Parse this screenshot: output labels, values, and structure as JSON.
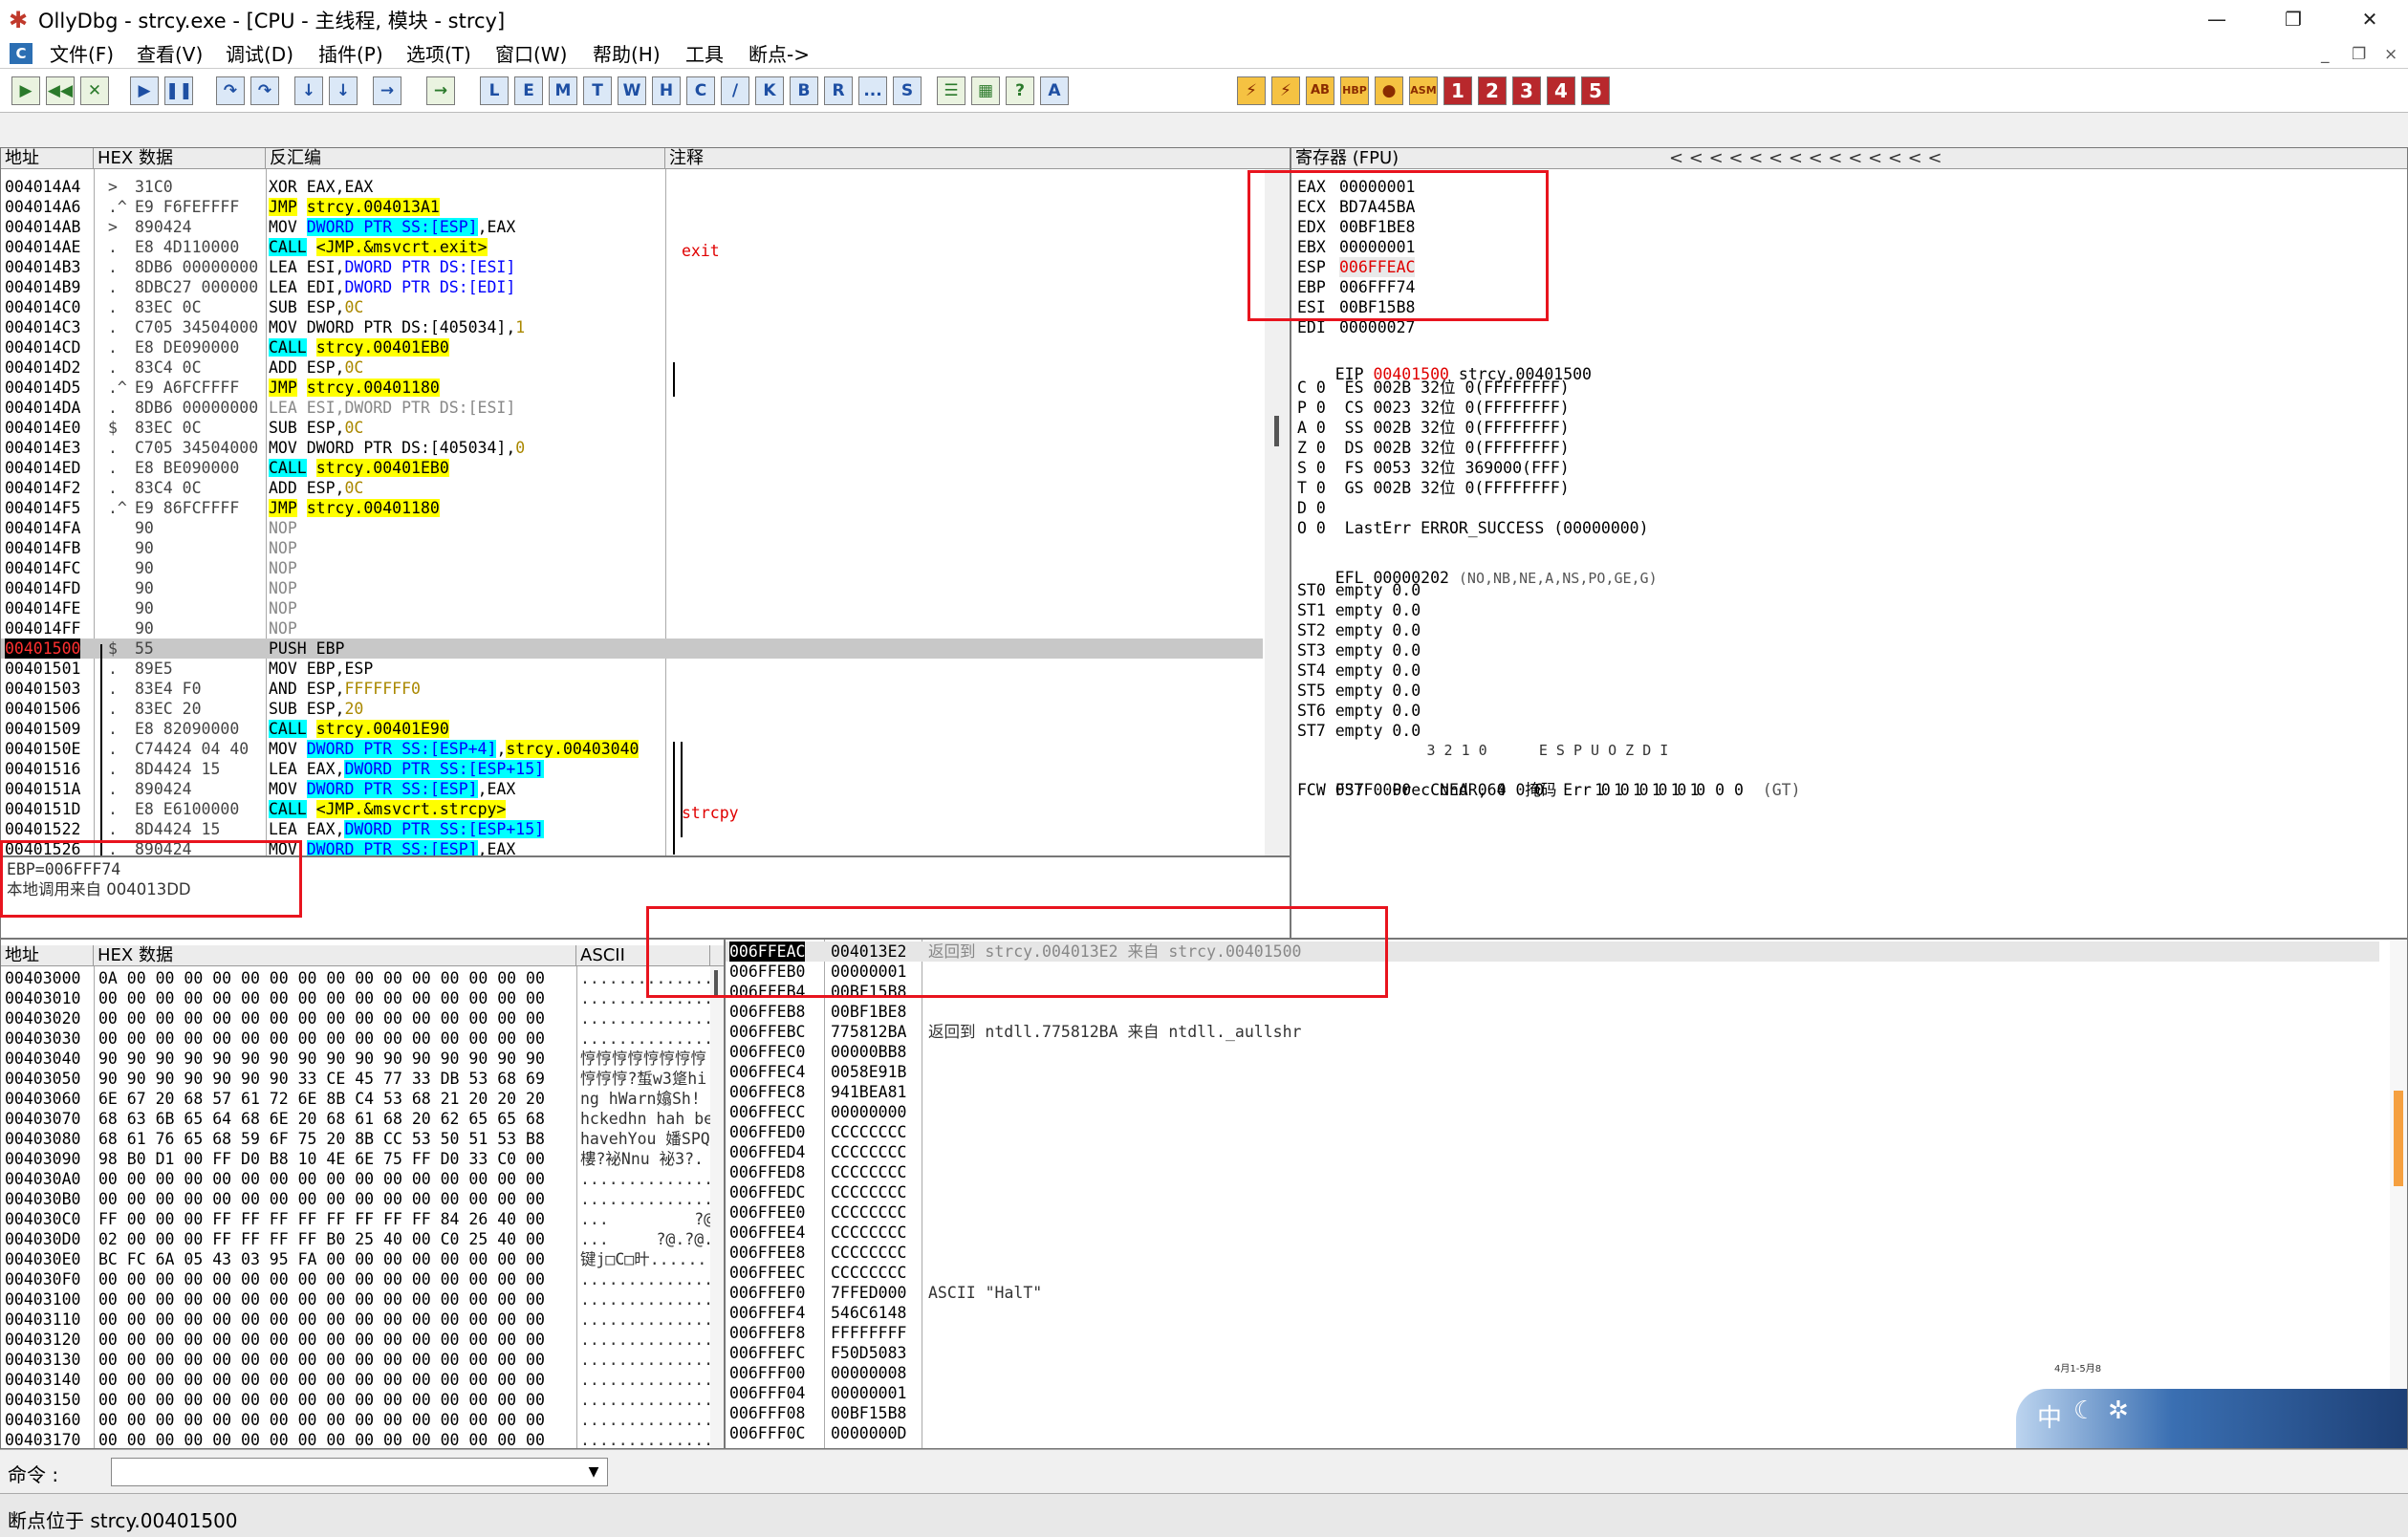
{
  "window": {
    "title": "OllyDbg - strcy.exe - [CPU - 主线程, 模块 - strcy]",
    "controls": [
      "—",
      "❐",
      "✕"
    ]
  },
  "menu": {
    "items": [
      "文件(F)",
      "查看(V)",
      "调试(D)",
      "插件(P)",
      "选项(T)",
      "窗口(W)",
      "帮助(H)",
      "工具",
      "断点->"
    ],
    "mdi_controls": [
      "_",
      "❐",
      "×"
    ]
  },
  "toolbar": {
    "nav_buttons": [
      "▶",
      "◀◀",
      "✕",
      "▶",
      "❚❚",
      "↷",
      "↷",
      "↓",
      "↓",
      "→",
      "→"
    ],
    "letter_buttons": [
      "L",
      "E",
      "M",
      "T",
      "W",
      "H",
      "C",
      "/",
      "K",
      "B",
      "R",
      "...",
      "S"
    ],
    "misc_buttons": [
      "☰",
      "▦",
      "?",
      "A"
    ],
    "right_buttons": [
      "⚡",
      "⚡",
      "AB",
      "HBP",
      "●",
      "ASM"
    ],
    "number_buttons": [
      "1",
      "2",
      "3",
      "4",
      "5"
    ]
  },
  "disasm": {
    "headers": [
      "地址",
      "HEX 数据",
      "反汇编",
      "注释"
    ],
    "rows": [
      {
        "addr": "004014A4",
        "m": ">",
        "hex": "31C0",
        "dis": [
          {
            "t": "XOR EAX,EAX"
          }
        ]
      },
      {
        "addr": "004014A6",
        "m": ".^",
        "hex": "E9 F6FEFFFF",
        "dis": [
          {
            "t": "JMP",
            "h": "y"
          },
          {
            "t": " "
          },
          {
            "t": "strcy.004013A1",
            "h": "y"
          }
        ]
      },
      {
        "addr": "004014AB",
        "m": ">",
        "hex": "890424",
        "dis": [
          {
            "t": "MOV "
          },
          {
            "t": "DWORD PTR SS:[ESP]",
            "h": "c"
          },
          {
            "t": ",EAX"
          }
        ]
      },
      {
        "addr": "004014AE",
        "m": ".",
        "hex": "E8 4D110000",
        "dis": [
          {
            "t": "CALL",
            "h": "c"
          },
          {
            "t": " "
          },
          {
            "t": "<JMP.&msvcrt.exit>",
            "h": "y"
          }
        ]
      },
      {
        "addr": "004014B3",
        "m": ".",
        "hex": "8DB6 00000000",
        "dis": [
          {
            "t": "LEA ESI,"
          },
          {
            "t": "DWORD PTR DS:[ESI]",
            "h": "b"
          }
        ]
      },
      {
        "addr": "004014B9",
        "m": ".",
        "hex": "8DBC27 000000",
        "dis": [
          {
            "t": "LEA EDI,"
          },
          {
            "t": "DWORD PTR DS:[EDI]",
            "h": "b"
          }
        ]
      },
      {
        "addr": "004014C0",
        "m": ".",
        "hex": "83EC 0C",
        "dis": [
          {
            "t": "SUB ESP,"
          },
          {
            "t": "0C",
            "h": "o"
          }
        ]
      },
      {
        "addr": "004014C3",
        "m": ".",
        "hex": "C705 34504000",
        "dis": [
          {
            "t": "MOV DWORD PTR DS:[405034],"
          },
          {
            "t": "1",
            "h": "o"
          }
        ]
      },
      {
        "addr": "004014CD",
        "m": ".",
        "hex": "E8 DE090000",
        "dis": [
          {
            "t": "CALL",
            "h": "c"
          },
          {
            "t": " "
          },
          {
            "t": "strcy.00401EB0",
            "h": "y"
          }
        ]
      },
      {
        "addr": "004014D2",
        "m": ".",
        "hex": "83C4 0C",
        "dis": [
          {
            "t": "ADD ESP,"
          },
          {
            "t": "0C",
            "h": "o"
          }
        ]
      },
      {
        "addr": "004014D5",
        "m": ".^",
        "hex": "E9 A6FCFFFF",
        "dis": [
          {
            "t": "JMP",
            "h": "y"
          },
          {
            "t": " "
          },
          {
            "t": "strcy.00401180",
            "h": "y"
          }
        ]
      },
      {
        "addr": "004014DA",
        "m": ".",
        "hex": "8DB6 00000000",
        "dis": [
          {
            "t": "LEA ESI,DWORD PTR DS:[ESI]",
            "h": "g"
          }
        ]
      },
      {
        "addr": "004014E0",
        "m": "$",
        "hex": "83EC 0C",
        "dis": [
          {
            "t": "SUB ESP,"
          },
          {
            "t": "0C",
            "h": "o"
          }
        ]
      },
      {
        "addr": "004014E3",
        "m": ".",
        "hex": "C705 34504000",
        "dis": [
          {
            "t": "MOV DWORD PTR DS:[405034],"
          },
          {
            "t": "0",
            "h": "o"
          }
        ]
      },
      {
        "addr": "004014ED",
        "m": ".",
        "hex": "E8 BE090000",
        "dis": [
          {
            "t": "CALL",
            "h": "c"
          },
          {
            "t": " "
          },
          {
            "t": "strcy.00401EB0",
            "h": "y"
          }
        ]
      },
      {
        "addr": "004014F2",
        "m": ".",
        "hex": "83C4 0C",
        "dis": [
          {
            "t": "ADD ESP,"
          },
          {
            "t": "0C",
            "h": "o"
          }
        ]
      },
      {
        "addr": "004014F5",
        "m": ".^",
        "hex": "E9 86FCFFFF",
        "dis": [
          {
            "t": "JMP",
            "h": "y"
          },
          {
            "t": " "
          },
          {
            "t": "strcy.00401180",
            "h": "y"
          }
        ]
      },
      {
        "addr": "004014FA",
        "m": "",
        "hex": "90",
        "dis": [
          {
            "t": "NOP",
            "h": "g"
          }
        ]
      },
      {
        "addr": "004014FB",
        "m": "",
        "hex": "90",
        "dis": [
          {
            "t": "NOP",
            "h": "g"
          }
        ]
      },
      {
        "addr": "004014FC",
        "m": "",
        "hex": "90",
        "dis": [
          {
            "t": "NOP",
            "h": "g"
          }
        ]
      },
      {
        "addr": "004014FD",
        "m": "",
        "hex": "90",
        "dis": [
          {
            "t": "NOP",
            "h": "g"
          }
        ]
      },
      {
        "addr": "004014FE",
        "m": "",
        "hex": "90",
        "dis": [
          {
            "t": "NOP",
            "h": "g"
          }
        ]
      },
      {
        "addr": "004014FF",
        "m": "",
        "hex": "90",
        "dis": [
          {
            "t": "NOP",
            "h": "g"
          }
        ]
      },
      {
        "addr": "00401500",
        "m": "$",
        "hex": "55",
        "dis": [
          {
            "t": "PUSH EBP"
          }
        ],
        "sel": true
      },
      {
        "addr": "00401501",
        "m": ".",
        "hex": "89E5",
        "dis": [
          {
            "t": "MOV EBP,ESP"
          }
        ]
      },
      {
        "addr": "00401503",
        "m": ".",
        "hex": "83E4 F0",
        "dis": [
          {
            "t": "AND ESP,"
          },
          {
            "t": "FFFFFFF0",
            "h": "o"
          }
        ]
      },
      {
        "addr": "00401506",
        "m": ".",
        "hex": "83EC 20",
        "dis": [
          {
            "t": "SUB ESP,"
          },
          {
            "t": "20",
            "h": "o"
          }
        ]
      },
      {
        "addr": "00401509",
        "m": ".",
        "hex": "E8 82090000",
        "dis": [
          {
            "t": "CALL",
            "h": "c"
          },
          {
            "t": " "
          },
          {
            "t": "strcy.00401E90",
            "h": "y"
          }
        ]
      },
      {
        "addr": "0040150E",
        "m": ".",
        "hex": "C74424 04 40",
        "dis": [
          {
            "t": "MOV "
          },
          {
            "t": "DWORD PTR SS:[ESP+4]",
            "h": "c"
          },
          {
            "t": ","
          },
          {
            "t": "strcy.00403040",
            "h": "y"
          }
        ]
      },
      {
        "addr": "00401516",
        "m": ".",
        "hex": "8D4424 15",
        "dis": [
          {
            "t": "LEA EAX,"
          },
          {
            "t": "DWORD PTR SS:[ESP+15]",
            "h": "c"
          }
        ]
      },
      {
        "addr": "0040151A",
        "m": ".",
        "hex": "890424",
        "dis": [
          {
            "t": "MOV "
          },
          {
            "t": "DWORD PTR SS:[ESP]",
            "h": "c"
          },
          {
            "t": ",EAX"
          }
        ]
      },
      {
        "addr": "0040151D",
        "m": ".",
        "hex": "E8 E6100000",
        "dis": [
          {
            "t": "CALL",
            "h": "c"
          },
          {
            "t": " "
          },
          {
            "t": "<JMP.&msvcrt.strcpy>",
            "h": "y"
          }
        ]
      },
      {
        "addr": "00401522",
        "m": ".",
        "hex": "8D4424 15",
        "dis": [
          {
            "t": "LEA EAX,"
          },
          {
            "t": "DWORD PTR SS:[ESP+15]",
            "h": "c"
          }
        ]
      },
      {
        "addr": "00401526",
        "m": ".",
        "hex": "890424",
        "dis": [
          {
            "t": "MOV "
          },
          {
            "t": "DWORD PTR SS:[ESP]",
            "h": "c"
          },
          {
            "t": ",EAX"
          }
        ]
      }
    ],
    "comments": [
      {
        "row": 3,
        "text": "exit"
      },
      {
        "row": 31,
        "text": "strcpy"
      }
    ]
  },
  "info": {
    "line1": "EBP=006FFF74",
    "line2": "本地调用来自 004013DD"
  },
  "registers": {
    "title": "寄存器 (FPU)",
    "nav_arrows": "<   <   <   <   <   <   <   <   <   <   <   <   <   <",
    "gp": [
      {
        "name": "EAX",
        "val": "00000001",
        "note": ""
      },
      {
        "name": "ECX",
        "val": "BD7A45BA",
        "note": ""
      },
      {
        "name": "EDX",
        "val": "00BF1BE8",
        "note": ""
      },
      {
        "name": "EBX",
        "val": "00000001",
        "note": ""
      },
      {
        "name": "ESP",
        "val": "006FFEAC",
        "note": "",
        "hl": true
      },
      {
        "name": "EBP",
        "val": "006FFF74",
        "note": ""
      },
      {
        "name": "ESI",
        "val": "00BF15B8",
        "note": ""
      },
      {
        "name": "EDI",
        "val": "00000027",
        "note": ""
      }
    ],
    "eip": {
      "name": "EIP",
      "val": "00401500",
      "note": "strcy.00401500"
    },
    "flags": [
      "C 0  ES 002B 32位 0(FFFFFFFF)",
      "P 0  CS 0023 32位 0(FFFFFFFF)",
      "A 0  SS 002B 32位 0(FFFFFFFF)",
      "Z 0  DS 002B 32位 0(FFFFFFFF)",
      "S 0  FS 0053 32位 369000(FFF)",
      "T 0  GS 002B 32位 0(FFFFFFFF)",
      "D 0",
      "O 0  LastErr ERROR_SUCCESS (00000000)"
    ],
    "efl": {
      "label": "EFL 00000202",
      "note": "(NO,NB,NE,A,NS,PO,GE,G)"
    },
    "fpu": [
      "ST0 empty 0.0",
      "ST1 empty 0.0",
      "ST2 empty 0.0",
      "ST3 empty 0.0",
      "ST4 empty 0.0",
      "ST5 empty 0.0",
      "ST6 empty 0.0",
      "ST7 empty 0.0"
    ],
    "fpu_hdr": "               3 2 1 0      E S P U O Z D I",
    "fst": "FST 0000  Cond 0 0 0 0  Err 0 0 0 0 0 0 0 0",
    "fst_note": "(GT)",
    "fcw": "FCW 037F  Prec NEAR,64  掩码    1 1 1 1 1 1"
  },
  "dump": {
    "headers": [
      "地址",
      "HEX 数据",
      "ASCII"
    ],
    "rows": [
      {
        "addr": "00403000",
        "hex": "0A 00 00 00 00 00 00 00 00 00 00 00 00 00 00 00",
        "ascii": "................"
      },
      {
        "addr": "00403010",
        "hex": "00 00 00 00 00 00 00 00 00 00 00 00 00 00 00 00",
        "ascii": "................"
      },
      {
        "addr": "00403020",
        "hex": "00 00 00 00 00 00 00 00 00 00 00 00 00 00 00 00",
        "ascii": "................"
      },
      {
        "addr": "00403030",
        "hex": "00 00 00 00 00 00 00 00 00 00 00 00 00 00 00 00",
        "ascii": "................"
      },
      {
        "addr": "00403040",
        "hex": "90 90 90 90 90 90 90 90 90 90 90 90 90 90 90 90",
        "ascii": "悙悙悙悙悙悙悙悙"
      },
      {
        "addr": "00403050",
        "hex": "90 90 90 90 90 90 90 33 CE 45 77 33 DB 53 68 69",
        "ascii": "悙悙悙?蜤w3跾hi"
      },
      {
        "addr": "00403060",
        "hex": "6E 67 20 68 57 61 72 6E 8B C4 53 68 21 20 20 20",
        "ascii": "ng hWarn嬆Sh!   "
      },
      {
        "addr": "00403070",
        "hex": "68 63 6B 65 64 68 6E 20 68 61 68 20 62 65 65 68",
        "ascii": "hckedhn hah beeh"
      },
      {
        "addr": "00403080",
        "hex": "68 61 76 65 68 59 6F 75 20 8B CC 53 50 51 53 B8",
        "ascii": "havehYou 嬏SPQS"
      },
      {
        "addr": "00403090",
        "hex": "98 B0 D1 00 FF D0 B8 10 4E 6E 75 FF D0 33 C0 00",
        "ascii": "樓?袐Nnu 袐3?."
      },
      {
        "addr": "004030A0",
        "hex": "00 00 00 00 00 00 00 00 00 00 00 00 00 00 00 00",
        "ascii": "................"
      },
      {
        "addr": "004030B0",
        "hex": "00 00 00 00 00 00 00 00 00 00 00 00 00 00 00 00",
        "ascii": "................"
      },
      {
        "addr": "004030C0",
        "hex": "FF 00 00 00 FF FF FF FF FF FF FF FF 84 26 40 00",
        "ascii": "...         ?@."
      },
      {
        "addr": "004030D0",
        "hex": "02 00 00 00 FF FF FF FF B0 25 40 00 C0 25 40 00",
        "ascii": "...     ?@.?@."
      },
      {
        "addr": "004030E0",
        "hex": "BC FC 6A 05 43 03 95 FA 00 00 00 00 00 00 00 00",
        "ascii": "键j□C□旪........"
      },
      {
        "addr": "004030F0",
        "hex": "00 00 00 00 00 00 00 00 00 00 00 00 00 00 00 00",
        "ascii": "................"
      },
      {
        "addr": "00403100",
        "hex": "00 00 00 00 00 00 00 00 00 00 00 00 00 00 00 00",
        "ascii": "................"
      },
      {
        "addr": "00403110",
        "hex": "00 00 00 00 00 00 00 00 00 00 00 00 00 00 00 00",
        "ascii": "................"
      },
      {
        "addr": "00403120",
        "hex": "00 00 00 00 00 00 00 00 00 00 00 00 00 00 00 00",
        "ascii": "................"
      },
      {
        "addr": "00403130",
        "hex": "00 00 00 00 00 00 00 00 00 00 00 00 00 00 00 00",
        "ascii": "................"
      },
      {
        "addr": "00403140",
        "hex": "00 00 00 00 00 00 00 00 00 00 00 00 00 00 00 00",
        "ascii": "................"
      },
      {
        "addr": "00403150",
        "hex": "00 00 00 00 00 00 00 00 00 00 00 00 00 00 00 00",
        "ascii": "................"
      },
      {
        "addr": "00403160",
        "hex": "00 00 00 00 00 00 00 00 00 00 00 00 00 00 00 00",
        "ascii": "................"
      },
      {
        "addr": "00403170",
        "hex": "00 00 00 00 00 00 00 00 00 00 00 00 00 00 00 00",
        "ascii": "................"
      }
    ]
  },
  "stack": {
    "rows": [
      {
        "addr": "006FFEAC",
        "val": "004013E2",
        "note": "返回到 strcy.004013E2 来自 strcy.00401500",
        "sel": true
      },
      {
        "addr": "006FFEB0",
        "val": "00000001",
        "note": ""
      },
      {
        "addr": "006FFEB4",
        "val": "00BF15B8",
        "note": ""
      },
      {
        "addr": "006FFEB8",
        "val": "00BF1BE8",
        "note": ""
      },
      {
        "addr": "006FFEBC",
        "val": "775812BA",
        "note": "返回到 ntdll.775812BA 来自 ntdll._aullshr"
      },
      {
        "addr": "006FFEC0",
        "val": "00000BB8",
        "note": ""
      },
      {
        "addr": "006FFEC4",
        "val": "0058E91B",
        "note": ""
      },
      {
        "addr": "006FFEC8",
        "val": "941BEA81",
        "note": ""
      },
      {
        "addr": "006FFECC",
        "val": "00000000",
        "note": ""
      },
      {
        "addr": "006FFED0",
        "val": "CCCCCCCC",
        "note": ""
      },
      {
        "addr": "006FFED4",
        "val": "CCCCCCCC",
        "note": ""
      },
      {
        "addr": "006FFED8",
        "val": "CCCCCCCC",
        "note": ""
      },
      {
        "addr": "006FFEDC",
        "val": "CCCCCCCC",
        "note": ""
      },
      {
        "addr": "006FFEE0",
        "val": "CCCCCCCC",
        "note": ""
      },
      {
        "addr": "006FFEE4",
        "val": "CCCCCCCC",
        "note": ""
      },
      {
        "addr": "006FFEE8",
        "val": "CCCCCCCC",
        "note": ""
      },
      {
        "addr": "006FFEEC",
        "val": "CCCCCCCC",
        "note": ""
      },
      {
        "addr": "006FFEF0",
        "val": "7FFED000",
        "note": "ASCII \"HalT\""
      },
      {
        "addr": "006FFEF4",
        "val": "546C6148",
        "note": ""
      },
      {
        "addr": "006FFEF8",
        "val": "FFFFFFFF",
        "note": ""
      },
      {
        "addr": "006FFEFC",
        "val": "F50D5083",
        "note": ""
      },
      {
        "addr": "006FFF00",
        "val": "00000008",
        "note": ""
      },
      {
        "addr": "006FFF04",
        "val": "00000001",
        "note": ""
      },
      {
        "addr": "006FFF08",
        "val": "00BF15B8",
        "note": ""
      },
      {
        "addr": "006FFF0C",
        "val": "0000000D",
        "note": ""
      }
    ]
  },
  "command": {
    "label": "命令 :",
    "value": ""
  },
  "status": {
    "text": "断点位于 strcy.00401500"
  },
  "tray": {
    "ime": "中",
    "date": "4月1-5月8"
  },
  "colors": {
    "highlight_yellow": "#ffff00",
    "highlight_cyan": "#00ffff",
    "annotation_red": "#e8141e",
    "eip_red": "#e00000"
  }
}
